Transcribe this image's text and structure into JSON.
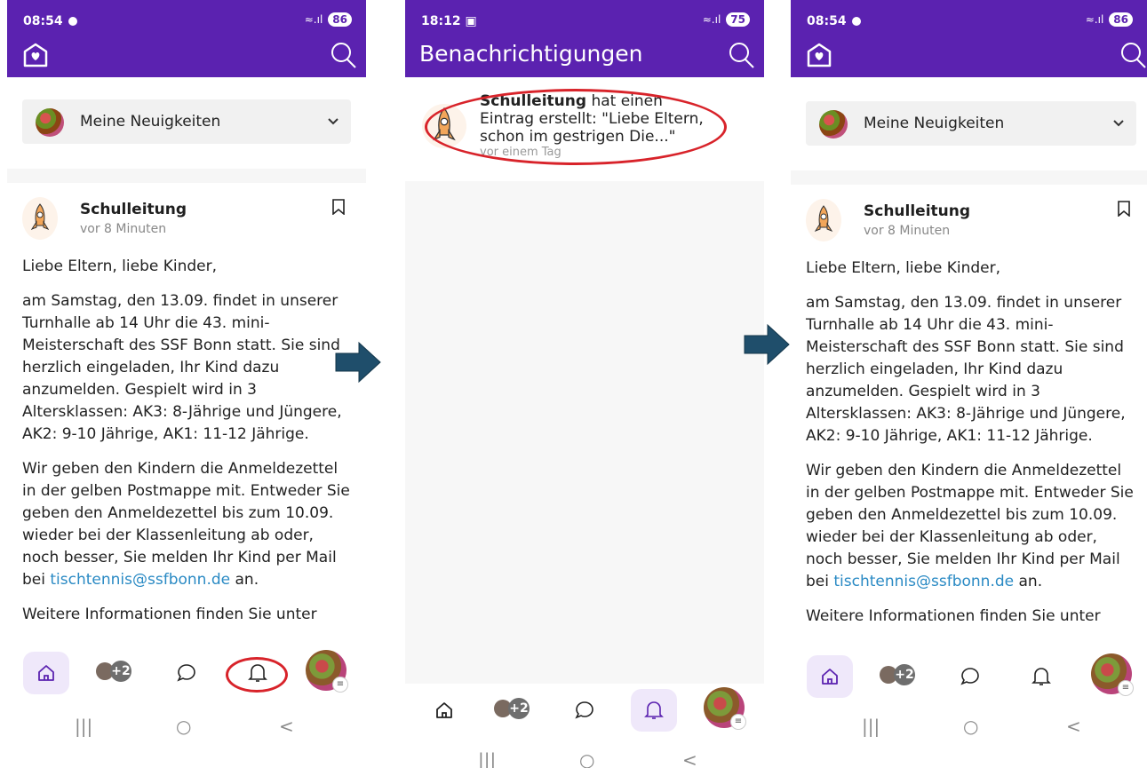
{
  "status": {
    "time_a": "08:54",
    "time_b": "18:12",
    "battery_a": "86",
    "battery_b": "75"
  },
  "selector": {
    "label": "Meine Neuigkeiten"
  },
  "post": {
    "author": "Schulleitung",
    "time": "vor 8 Minuten",
    "greeting": "Liebe Eltern, liebe Kinder,",
    "para1": "am Samstag, den 13.09. findet in unserer Turnhalle ab 14 Uhr die 43. mini-Meisterschaft des SSF Bonn statt. Sie sind herzlich eingeladen, Ihr Kind dazu anzumelden. Gespielt wird in 3 Altersklassen: AK3: 8-Jährige und Jüngere, AK2: 9-10 Jährige, AK1: 11-12 Jährige.",
    "para2_before": "Wir geben den Kindern die Anmeldezettel in der gelben Postmappe mit. Entweder Sie geben den Anmeldezettel bis zum 10.09. wieder bei der Klassenleitung ab oder, noch besser, Sie melden Ihr Kind per Mail bei",
    "para2_mail": "tischtennis@ssfbonn.de",
    "para2_after": " an.",
    "para3": "Weitere Informationen finden Sie unter"
  },
  "notifications": {
    "title": "Benachrichtigungen",
    "items": [
      {
        "author": "Schulleitung",
        "text": " hat einen Eintrag erstellt: \"Liebe Eltern, schon im gestrigen Die...\"",
        "time": "vor einem Tag"
      }
    ]
  },
  "nav": {
    "groups_badge": "+2"
  },
  "icons": [
    "home-icon",
    "search-icon",
    "chevron-down-icon",
    "bookmark-icon",
    "chat-icon",
    "bell-icon",
    "groups-icon",
    "profile-avatar",
    "right-arrow-icon"
  ],
  "colors": {
    "brand": "#5b22b0",
    "active_bg": "#efe8fa",
    "link": "#2a8ac4",
    "highlight": "#d8232a",
    "arrow": "#1f4e6b"
  }
}
